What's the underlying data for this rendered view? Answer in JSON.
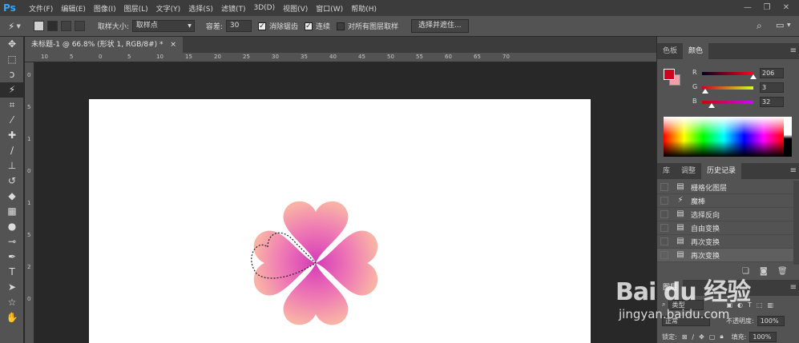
{
  "app": {
    "logo": "Ps"
  },
  "menu": [
    "文件(F)",
    "编辑(E)",
    "图像(I)",
    "图层(L)",
    "文字(Y)",
    "选择(S)",
    "滤镜(T)",
    "3D(D)",
    "视图(V)",
    "窗口(W)",
    "帮助(H)"
  ],
  "window_controls": {
    "minimize": "—",
    "restore": "❐",
    "close": "✕"
  },
  "options": {
    "sample_size_label": "取样大小:",
    "sample_size_value": "取样点",
    "tolerance_label": "容差:",
    "tolerance_value": "30",
    "antialias_label": "消除锯齿",
    "contiguous_label": "连续",
    "all_layers_label": "对所有图层取样",
    "select_mask_button": "选择并遮住..."
  },
  "document": {
    "tab_title": "未标题-1 @ 66.8% (形状 1, RGB/8#) *",
    "close": "×"
  },
  "ruler_h_ticks": [
    "10",
    "5",
    "0",
    "5",
    "10",
    "15",
    "20",
    "25",
    "30",
    "35",
    "40",
    "45",
    "50",
    "55",
    "60",
    "65",
    "70"
  ],
  "ruler_v_ticks": [
    "0",
    "5",
    "1",
    "0",
    "1",
    "5",
    "2",
    "0"
  ],
  "color_panel": {
    "tabs": [
      "色板",
      "颜色"
    ],
    "active_tab": "颜色",
    "foreground": "#ce0320",
    "background": "#f2a0a8",
    "r_label": "R",
    "g_label": "G",
    "b_label": "B",
    "r": "206",
    "g": "3",
    "b": "32"
  },
  "history_panel": {
    "tabs": [
      "库",
      "调整",
      "历史记录"
    ],
    "active_tab": "历史记录",
    "items": [
      "栅格化图层",
      "魔棒",
      "选择反向",
      "自由变换",
      "再次变换",
      "再次变换"
    ],
    "selected_index": 5
  },
  "layers_panel": {
    "tab": "图层",
    "filter_label": "类型",
    "blend_mode": "正常",
    "opacity_label": "不透明度:",
    "opacity_value": "100%",
    "lock_label": "锁定:",
    "fill_label": "填充:",
    "fill_value": "100%"
  },
  "watermark": {
    "logo": "Bai du 经验",
    "url": "jingyan.baidu.com"
  }
}
